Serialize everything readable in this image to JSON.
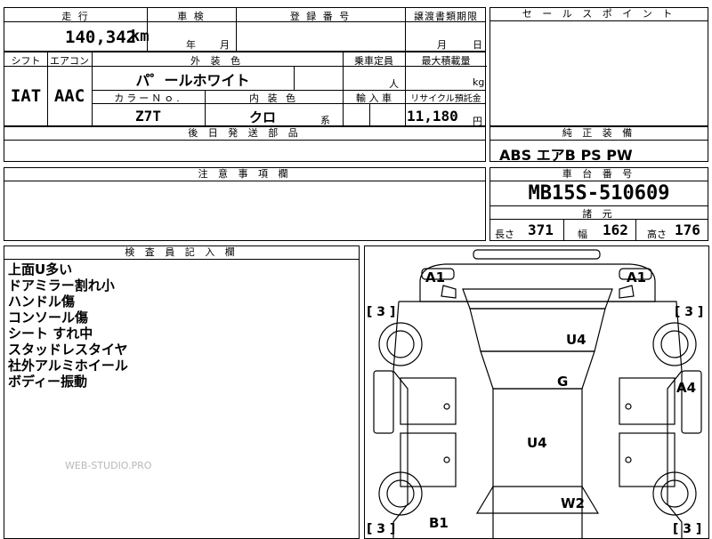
{
  "row1": {
    "mileage_header": "走 行",
    "inspection_header": "車 検",
    "registration_header": "登 録 番 号",
    "transfer_header": "譲渡書類期限",
    "mileage_value": "140,342",
    "mileage_unit": "km",
    "inspection_year": "年",
    "inspection_month": "月",
    "transfer_month": "月",
    "transfer_day": "日"
  },
  "row2": {
    "shift_header": "シフト",
    "ac_header": "エアコン",
    "exterior_header": "外 装 色",
    "capacity_header": "乗車定員",
    "load_header": "最大積載量",
    "shift_value": "IAT",
    "ac_value": "AAC",
    "exterior_value": "パ゜ールホワイト",
    "capacity_unit": "人",
    "load_unit": "kg",
    "color_no_header": "カラーＮｏ.",
    "interior_header": "内 装 色",
    "import_header": "輸 入 車",
    "recycle_header": "リサイクル預託金",
    "color_no_value": "Z7T",
    "interior_value": "クロ",
    "interior_suffix": "系",
    "recycle_value": "11,180",
    "recycle_unit": "円"
  },
  "later_parts_header": "後 日 発 送 部 品",
  "sales_point_header": "セ ー ル ス ポ イ ン ト",
  "equipment": {
    "header": "純 正 装 備",
    "value": "ABS エアB PS PW"
  },
  "caution_header": "注 意 事 項 欄",
  "chassis": {
    "header": "車 台 番 号",
    "value": "MB15S-510609"
  },
  "specs": {
    "header": "諸 元",
    "length_label": "長さ",
    "length_value": "371",
    "width_label": "幅",
    "width_value": "162",
    "height_label": "高さ",
    "height_value": "176"
  },
  "inspector": {
    "header": "検 査 員 記 入 欄",
    "notes": [
      "上面U多い",
      "ドアミラー割れ小",
      "ハンドル傷",
      "コンソール傷",
      "シート すれ中",
      "スタッドレスタイヤ",
      "社外アルミホイール",
      "ボディー振動"
    ]
  },
  "watermark": "WEB-STUDIO.PRO",
  "diagram": {
    "marks": {
      "a1_left": "A1",
      "a1_right": "A1",
      "u4_top": "U4",
      "g": "G",
      "a4": "A4",
      "u4_mid": "U4",
      "w2": "W2",
      "b1": "B1"
    },
    "tires": {
      "tl": "[ 3 ]",
      "tr": "[ 3 ]",
      "bl": "[ 3 ]",
      "br": "[ 3 ]"
    }
  }
}
